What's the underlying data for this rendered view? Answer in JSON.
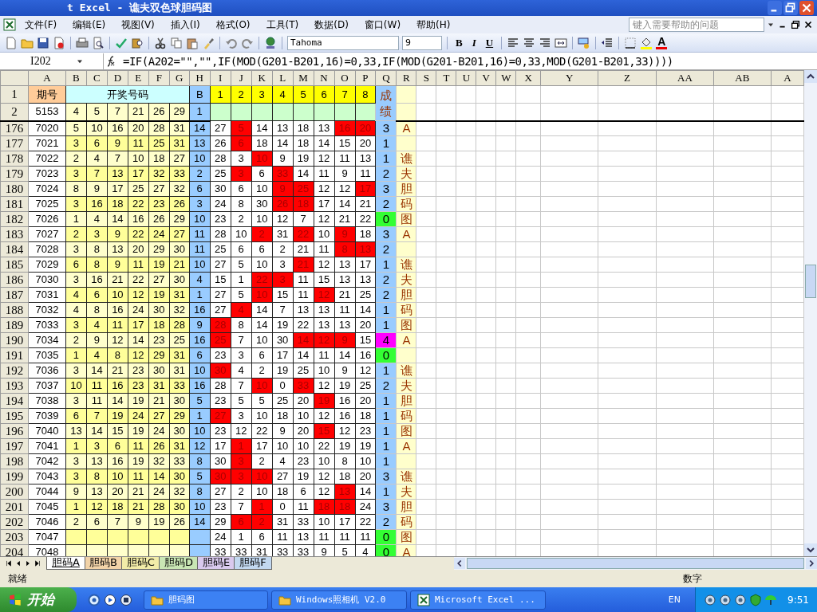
{
  "window": {
    "title": "t Excel - 谯夫双色球胆码图"
  },
  "menu": [
    "文件(F)",
    "编辑(E)",
    "视图(V)",
    "插入(I)",
    "格式(O)",
    "工具(T)",
    "数据(D)",
    "窗口(W)",
    "帮助(H)"
  ],
  "help_box": {
    "placeholder": "键入需要帮助的问题"
  },
  "toolbar": {
    "font": "Tahoma",
    "size": "9",
    "format_buttons": [
      "B",
      "I",
      "U"
    ],
    "font_color": "A"
  },
  "formula_bar": {
    "cell": "I202",
    "formula": "=IF(A202=\"\",\"\",IF(MOD(G201-B201,16)=0,33,IF(MOD(G201-B201,16)=0,33,MOD(G201-B201,33))))"
  },
  "sheet": {
    "columns": [
      "A",
      "B",
      "C",
      "D",
      "E",
      "F",
      "G",
      "H",
      "I",
      "J",
      "K",
      "L",
      "M",
      "N",
      "O",
      "P",
      "Q",
      "R",
      "S",
      "T",
      "U",
      "V",
      "W",
      "X",
      "Y",
      "Z",
      "AA",
      "AB",
      "A"
    ],
    "header": {
      "row": "1",
      "issue": "期号",
      "draw": "开奖号码",
      "b": "B",
      "numbers": [
        "1",
        "2",
        "3",
        "4",
        "5",
        "6",
        "7",
        "8"
      ],
      "score": "成绩"
    },
    "row2": {
      "row": "2",
      "issue": "5153",
      "draw": [
        "4",
        "5",
        "7",
        "21",
        "26",
        "29"
      ],
      "b": "1"
    },
    "rows": [
      {
        "row": "176",
        "issue": "7020",
        "draw": [
          "5",
          "10",
          "16",
          "20",
          "28",
          "31"
        ],
        "b": "14",
        "cells": [
          "27",
          "5",
          "14",
          "13",
          "18",
          "13",
          "16",
          "20"
        ],
        "hit": [
          false,
          true,
          false,
          false,
          false,
          false,
          true,
          true
        ],
        "score": "3",
        "color": "#99ccff",
        "mark": "A"
      },
      {
        "row": "177",
        "issue": "7021",
        "draw": [
          "3",
          "6",
          "9",
          "11",
          "25",
          "31"
        ],
        "b": "13",
        "cells": [
          "26",
          "6",
          "18",
          "14",
          "18",
          "14",
          "15",
          "20"
        ],
        "hit": [
          false,
          true,
          false,
          false,
          false,
          false,
          false,
          false
        ],
        "score": "1",
        "color": "#99ccff"
      },
      {
        "row": "178",
        "issue": "7022",
        "draw": [
          "2",
          "4",
          "7",
          "10",
          "18",
          "27"
        ],
        "b": "10",
        "cells": [
          "28",
          "3",
          "10",
          "9",
          "19",
          "12",
          "11",
          "13"
        ],
        "hit": [
          false,
          false,
          true,
          false,
          false,
          false,
          false,
          false
        ],
        "score": "1",
        "color": "#99ccff",
        "mark": "谯"
      },
      {
        "row": "179",
        "issue": "7023",
        "draw": [
          "3",
          "7",
          "13",
          "17",
          "32",
          "33"
        ],
        "b": "2",
        "cells": [
          "25",
          "3",
          "6",
          "33",
          "14",
          "11",
          "9",
          "11"
        ],
        "hit": [
          false,
          true,
          false,
          true,
          false,
          false,
          false,
          false
        ],
        "score": "2",
        "color": "#99ccff",
        "mark": "夫"
      },
      {
        "row": "180",
        "issue": "7024",
        "draw": [
          "8",
          "9",
          "17",
          "25",
          "27",
          "32"
        ],
        "b": "6",
        "cells": [
          "30",
          "6",
          "10",
          "9",
          "25",
          "12",
          "12",
          "17"
        ],
        "hit": [
          false,
          false,
          false,
          true,
          true,
          false,
          false,
          true
        ],
        "score": "3",
        "color": "#99ccff",
        "mark": "胆"
      },
      {
        "row": "181",
        "issue": "7025",
        "draw": [
          "3",
          "16",
          "18",
          "22",
          "23",
          "26"
        ],
        "b": "3",
        "cells": [
          "24",
          "8",
          "30",
          "26",
          "18",
          "17",
          "14",
          "21"
        ],
        "hit": [
          false,
          false,
          false,
          true,
          true,
          false,
          false,
          false
        ],
        "score": "2",
        "color": "#99ccff",
        "mark": "码"
      },
      {
        "row": "182",
        "issue": "7026",
        "draw": [
          "1",
          "4",
          "14",
          "16",
          "26",
          "29"
        ],
        "b": "10",
        "cells": [
          "23",
          "2",
          "10",
          "12",
          "7",
          "12",
          "21",
          "22"
        ],
        "hit": [
          false,
          false,
          false,
          false,
          false,
          false,
          false,
          false
        ],
        "score": "0",
        "color": "#33ff33",
        "mark": "图"
      },
      {
        "row": "183",
        "issue": "7027",
        "draw": [
          "2",
          "3",
          "9",
          "22",
          "24",
          "27"
        ],
        "b": "11",
        "cells": [
          "28",
          "10",
          "2",
          "31",
          "22",
          "10",
          "9",
          "18"
        ],
        "hit": [
          false,
          false,
          true,
          false,
          true,
          false,
          true,
          false
        ],
        "score": "3",
        "color": "#99ccff",
        "mark": "A"
      },
      {
        "row": "184",
        "issue": "7028",
        "draw": [
          "3",
          "8",
          "13",
          "20",
          "29",
          "30"
        ],
        "b": "11",
        "cells": [
          "25",
          "6",
          "6",
          "2",
          "21",
          "11",
          "8",
          "13"
        ],
        "hit": [
          false,
          false,
          false,
          false,
          false,
          false,
          true,
          true
        ],
        "score": "2",
        "color": "#99ccff"
      },
      {
        "row": "185",
        "issue": "7029",
        "draw": [
          "6",
          "8",
          "9",
          "11",
          "19",
          "21"
        ],
        "b": "10",
        "cells": [
          "27",
          "5",
          "10",
          "3",
          "21",
          "12",
          "13",
          "17"
        ],
        "hit": [
          false,
          false,
          false,
          false,
          true,
          false,
          false,
          false
        ],
        "score": "1",
        "color": "#99ccff",
        "mark": "谯"
      },
      {
        "row": "186",
        "issue": "7030",
        "draw": [
          "3",
          "16",
          "21",
          "22",
          "27",
          "30"
        ],
        "b": "4",
        "cells": [
          "15",
          "1",
          "22",
          "3",
          "11",
          "15",
          "13",
          "13"
        ],
        "hit": [
          false,
          false,
          true,
          true,
          false,
          false,
          false,
          false
        ],
        "score": "2",
        "color": "#99ccff",
        "mark": "夫"
      },
      {
        "row": "187",
        "issue": "7031",
        "draw": [
          "4",
          "6",
          "10",
          "12",
          "19",
          "31"
        ],
        "b": "1",
        "cells": [
          "27",
          "5",
          "10",
          "15",
          "11",
          "12",
          "21",
          "25"
        ],
        "hit": [
          false,
          false,
          true,
          false,
          false,
          true,
          false,
          false
        ],
        "score": "2",
        "color": "#99ccff",
        "mark": "胆"
      },
      {
        "row": "188",
        "issue": "7032",
        "draw": [
          "4",
          "8",
          "16",
          "24",
          "30",
          "32"
        ],
        "b": "16",
        "cells": [
          "27",
          "4",
          "14",
          "7",
          "13",
          "13",
          "11",
          "14"
        ],
        "hit": [
          false,
          true,
          false,
          false,
          false,
          false,
          false,
          false
        ],
        "score": "1",
        "color": "#99ccff",
        "mark": "码"
      },
      {
        "row": "189",
        "issue": "7033",
        "draw": [
          "3",
          "4",
          "11",
          "17",
          "18",
          "28"
        ],
        "b": "9",
        "cells": [
          "28",
          "8",
          "14",
          "19",
          "22",
          "13",
          "13",
          "20"
        ],
        "hit": [
          true,
          false,
          false,
          false,
          false,
          false,
          false,
          false
        ],
        "score": "1",
        "color": "#99ccff",
        "mark": "图"
      },
      {
        "row": "190",
        "issue": "7034",
        "draw": [
          "2",
          "9",
          "12",
          "14",
          "23",
          "25"
        ],
        "b": "16",
        "cells": [
          "25",
          "7",
          "10",
          "30",
          "14",
          "12",
          "9",
          "15"
        ],
        "hit": [
          true,
          false,
          false,
          false,
          true,
          true,
          true,
          false
        ],
        "score": "4",
        "color": "#ff00ff",
        "mark": "A"
      },
      {
        "row": "191",
        "issue": "7035",
        "draw": [
          "1",
          "4",
          "8",
          "12",
          "29",
          "31"
        ],
        "b": "6",
        "cells": [
          "23",
          "3",
          "6",
          "17",
          "14",
          "11",
          "14",
          "16"
        ],
        "hit": [
          false,
          false,
          false,
          false,
          false,
          false,
          false,
          false
        ],
        "score": "0",
        "color": "#33ff33"
      },
      {
        "row": "192",
        "issue": "7036",
        "draw": [
          "3",
          "14",
          "21",
          "23",
          "30",
          "31"
        ],
        "b": "10",
        "cells": [
          "30",
          "4",
          "2",
          "19",
          "25",
          "10",
          "9",
          "12"
        ],
        "hit": [
          true,
          false,
          false,
          false,
          false,
          false,
          false,
          false
        ],
        "score": "1",
        "color": "#99ccff",
        "mark": "谯"
      },
      {
        "row": "193",
        "issue": "7037",
        "draw": [
          "10",
          "11",
          "16",
          "23",
          "31",
          "33"
        ],
        "b": "16",
        "cells": [
          "28",
          "7",
          "10",
          "0",
          "33",
          "12",
          "19",
          "25"
        ],
        "hit": [
          false,
          false,
          true,
          false,
          true,
          false,
          false,
          false
        ],
        "score": "2",
        "color": "#99ccff",
        "mark": "夫"
      },
      {
        "row": "194",
        "issue": "7038",
        "draw": [
          "3",
          "11",
          "14",
          "19",
          "21",
          "30"
        ],
        "b": "5",
        "cells": [
          "23",
          "5",
          "5",
          "25",
          "20",
          "19",
          "16",
          "20"
        ],
        "hit": [
          false,
          false,
          false,
          false,
          false,
          true,
          false,
          false
        ],
        "score": "1",
        "color": "#99ccff",
        "mark": "胆"
      },
      {
        "row": "195",
        "issue": "7039",
        "draw": [
          "6",
          "7",
          "19",
          "24",
          "27",
          "29"
        ],
        "b": "1",
        "cells": [
          "27",
          "3",
          "10",
          "18",
          "10",
          "12",
          "16",
          "18"
        ],
        "hit": [
          true,
          false,
          false,
          false,
          false,
          false,
          false,
          false
        ],
        "score": "1",
        "color": "#99ccff",
        "mark": "码"
      },
      {
        "row": "196",
        "issue": "7040",
        "draw": [
          "13",
          "14",
          "15",
          "19",
          "24",
          "30"
        ],
        "b": "10",
        "cells": [
          "23",
          "12",
          "22",
          "9",
          "20",
          "15",
          "12",
          "23"
        ],
        "hit": [
          false,
          false,
          false,
          false,
          false,
          true,
          false,
          false
        ],
        "score": "1",
        "color": "#99ccff",
        "mark": "图"
      },
      {
        "row": "197",
        "issue": "7041",
        "draw": [
          "1",
          "3",
          "6",
          "11",
          "26",
          "31"
        ],
        "b": "12",
        "cells": [
          "17",
          "1",
          "17",
          "10",
          "10",
          "22",
          "19",
          "19"
        ],
        "hit": [
          false,
          true,
          false,
          false,
          false,
          false,
          false,
          false
        ],
        "score": "1",
        "color": "#99ccff",
        "mark": "A"
      },
      {
        "row": "198",
        "issue": "7042",
        "draw": [
          "3",
          "13",
          "16",
          "19",
          "32",
          "33"
        ],
        "b": "8",
        "cells": [
          "30",
          "3",
          "2",
          "4",
          "23",
          "10",
          "8",
          "10"
        ],
        "hit": [
          false,
          true,
          false,
          false,
          false,
          false,
          false,
          false
        ],
        "score": "1",
        "color": "#99ccff"
      },
      {
        "row": "199",
        "issue": "7043",
        "draw": [
          "3",
          "8",
          "10",
          "11",
          "14",
          "30"
        ],
        "b": "5",
        "cells": [
          "30",
          "3",
          "10",
          "27",
          "19",
          "12",
          "18",
          "20"
        ],
        "hit": [
          true,
          true,
          true,
          false,
          false,
          false,
          false,
          false
        ],
        "score": "3",
        "color": "#99ccff",
        "mark": "谯"
      },
      {
        "row": "200",
        "issue": "7044",
        "draw": [
          "9",
          "13",
          "20",
          "21",
          "24",
          "32"
        ],
        "b": "8",
        "cells": [
          "27",
          "2",
          "10",
          "18",
          "6",
          "12",
          "13",
          "14"
        ],
        "hit": [
          false,
          false,
          false,
          false,
          false,
          false,
          true,
          false
        ],
        "score": "1",
        "color": "#99ccff",
        "mark": "夫"
      },
      {
        "row": "201",
        "issue": "7045",
        "draw": [
          "1",
          "12",
          "18",
          "21",
          "28",
          "30"
        ],
        "b": "10",
        "cells": [
          "23",
          "7",
          "1",
          "0",
          "11",
          "18",
          "18",
          "24"
        ],
        "hit": [
          false,
          false,
          true,
          false,
          false,
          true,
          true,
          false
        ],
        "score": "3",
        "color": "#99ccff",
        "mark": "胆"
      },
      {
        "row": "202",
        "issue": "7046",
        "draw": [
          "2",
          "6",
          "7",
          "9",
          "19",
          "26"
        ],
        "b": "14",
        "cells": [
          "29",
          "6",
          "2",
          "31",
          "33",
          "10",
          "17",
          "22"
        ],
        "hit": [
          false,
          true,
          true,
          false,
          false,
          false,
          false,
          false
        ],
        "score": "2",
        "color": "#99ccff",
        "mark": "码"
      },
      {
        "row": "203",
        "issue": "7047",
        "cells": [
          "24",
          "1",
          "6",
          "11",
          "13",
          "11",
          "11",
          "11"
        ],
        "hit": [
          false,
          false,
          false,
          false,
          false,
          false,
          false,
          false
        ],
        "score": "0",
        "color": "#33ff33",
        "mark": "图"
      },
      {
        "row": "204",
        "issue": "7048",
        "cells": [
          "33",
          "33",
          "31",
          "33",
          "33",
          "9",
          "5",
          "4"
        ],
        "hit": [
          false,
          false,
          false,
          false,
          false,
          false,
          false,
          false
        ],
        "score": "0",
        "color": "#33ff33",
        "mark": "A"
      }
    ]
  },
  "sheet_tabs": [
    {
      "label": "胆码A",
      "selected": true
    },
    {
      "label": "胆码B",
      "selected": false,
      "color": "#f2d3a8"
    },
    {
      "label": "胆码C",
      "selected": false,
      "color": "#f2eca8"
    },
    {
      "label": "胆码D",
      "selected": false,
      "color": "#c9e6b4"
    },
    {
      "label": "胆码E",
      "selected": false,
      "color": "#d9c9ee"
    },
    {
      "label": "胆码F",
      "selected": false,
      "color": "#c2d8f0"
    }
  ],
  "status_bar": {
    "status": "就绪",
    "mode": "数字"
  },
  "taskbar": {
    "start": "开始",
    "tasks": [
      {
        "label": "胆码图",
        "kind": "folder"
      },
      {
        "label": "Windows照相机 V2.0",
        "kind": "folder"
      },
      {
        "label": "Microsoft Excel ...",
        "kind": "excel"
      }
    ],
    "language": "EN",
    "clock": "9:51"
  }
}
